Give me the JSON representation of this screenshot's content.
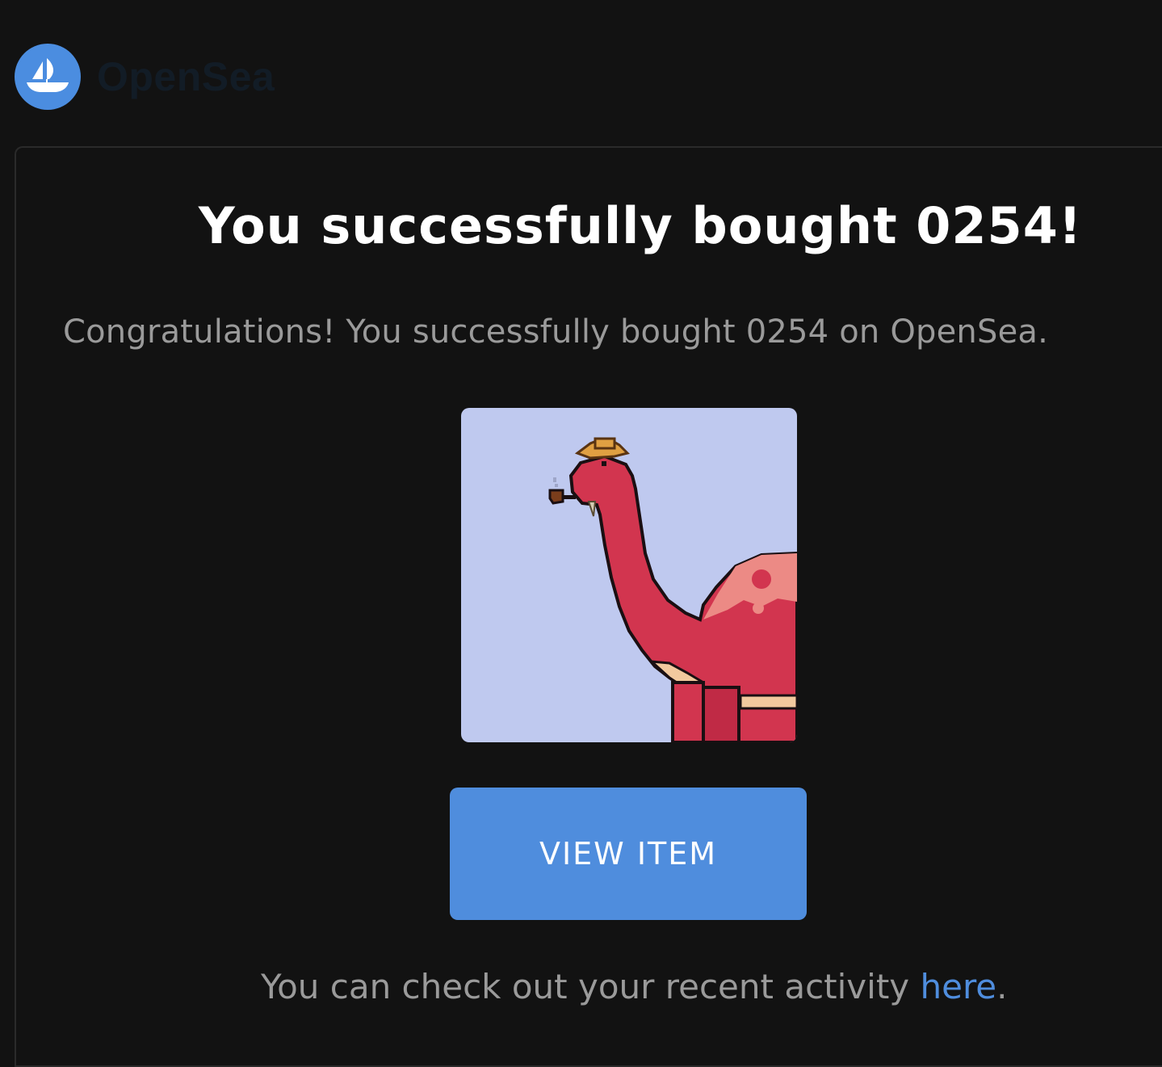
{
  "brand": {
    "name": "OpenSea",
    "logo_icon": "opensea-ship-icon",
    "accent": "#4f8ddd"
  },
  "email": {
    "title": "You successfully bought 0254!",
    "subtitle": "Congratulations! You successfully bought 0254 on OpenSea.",
    "item_image_icon": "pixel-dinosaur-nft-icon",
    "view_button_label": "VIEW ITEM",
    "footer_text": "You can check out your recent activity ",
    "footer_link_label": "here",
    "footer_end": "."
  }
}
